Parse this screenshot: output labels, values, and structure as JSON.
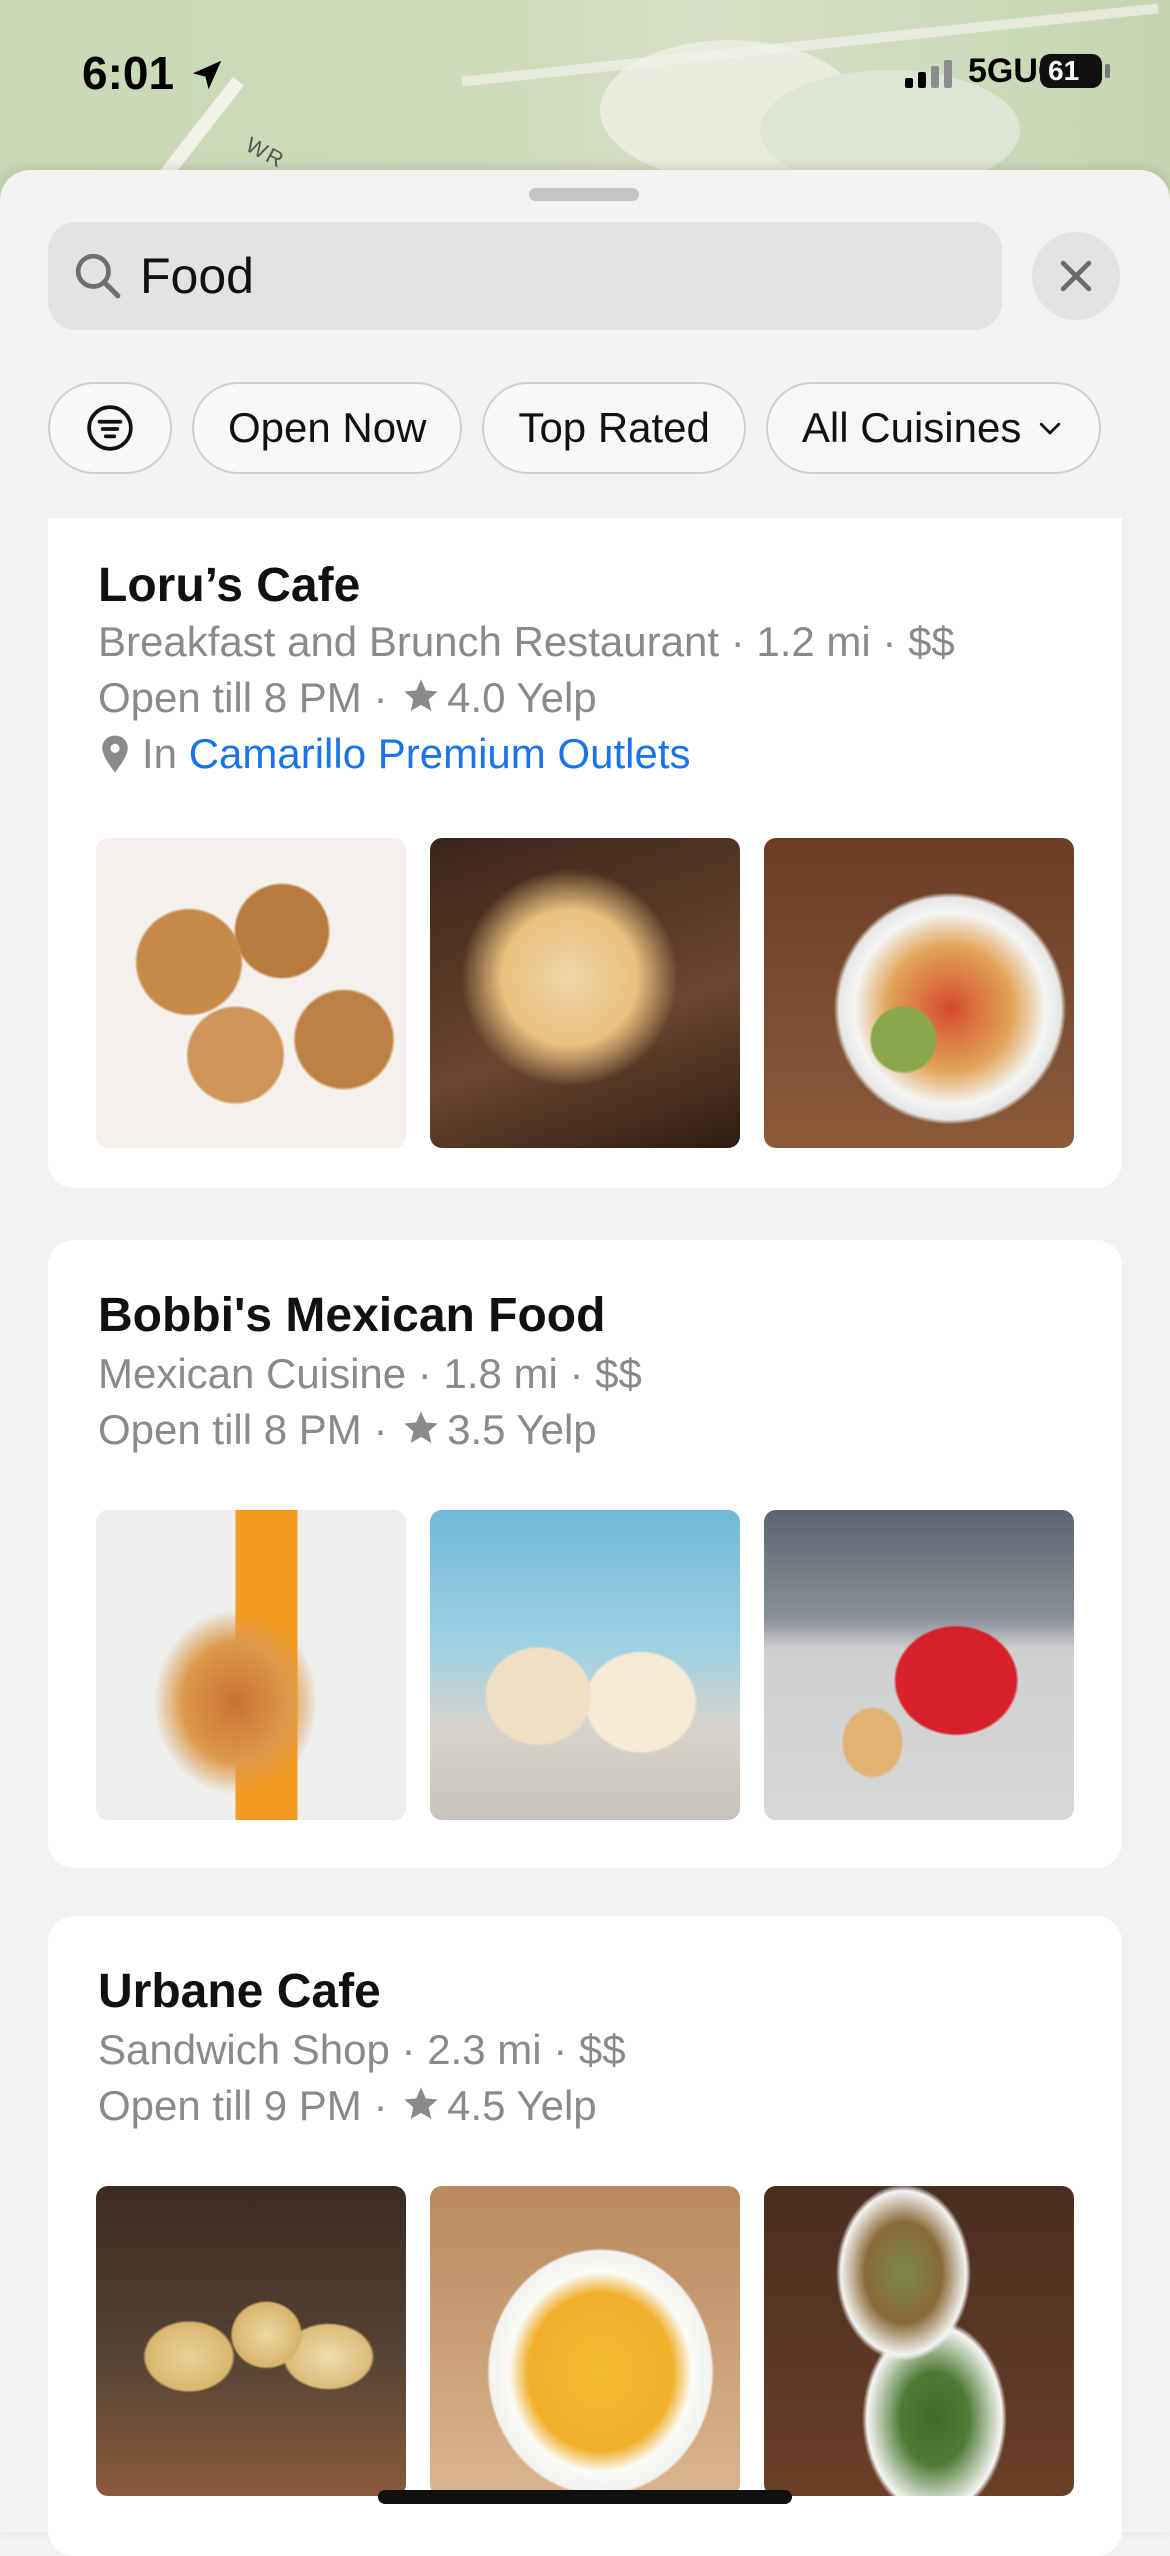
{
  "status_bar": {
    "time": "6:01",
    "network": "5GUC",
    "battery": "61"
  },
  "map": {
    "road_label": "WR"
  },
  "search": {
    "query": "Food"
  },
  "filters": {
    "chips": [
      "Open Now",
      "Top Rated",
      "All Cuisines"
    ]
  },
  "results": [
    {
      "name": "Loru’s Cafe",
      "category": "Breakfast and Brunch Restaurant",
      "distance": "1.2 mi",
      "price": "$$",
      "hours": "Open till 8 PM",
      "rating": "4.0",
      "rating_source": "Yelp",
      "location_prefix": "In",
      "location_link": "Camarillo Premium Outlets",
      "photos": [
        "cookies",
        "taco",
        "burrito-bowl"
      ]
    },
    {
      "name": "Bobbi's Mexican Food",
      "category": "Mexican Cuisine",
      "distance": "1.8 mi",
      "price": "$$",
      "hours": "Open till 8 PM",
      "rating": "3.5",
      "rating_source": "Yelp",
      "photos": [
        "chicken-biscuit",
        "milkshakes",
        "nuggets-box"
      ]
    },
    {
      "name": "Urbane Cafe",
      "category": "Sandwich Shop",
      "distance": "2.3 mi",
      "price": "$$",
      "hours": "Open till 9 PM",
      "rating": "4.5",
      "rating_source": "Yelp",
      "photos": [
        "garlic-bread",
        "mac-and-cheese",
        "salad-plates"
      ]
    }
  ],
  "colors": {
    "link": "#1a73e8",
    "secondary_text": "#8a8a8a",
    "card_bg": "#ffffff",
    "sheet_bg": "#f2f2f0"
  }
}
